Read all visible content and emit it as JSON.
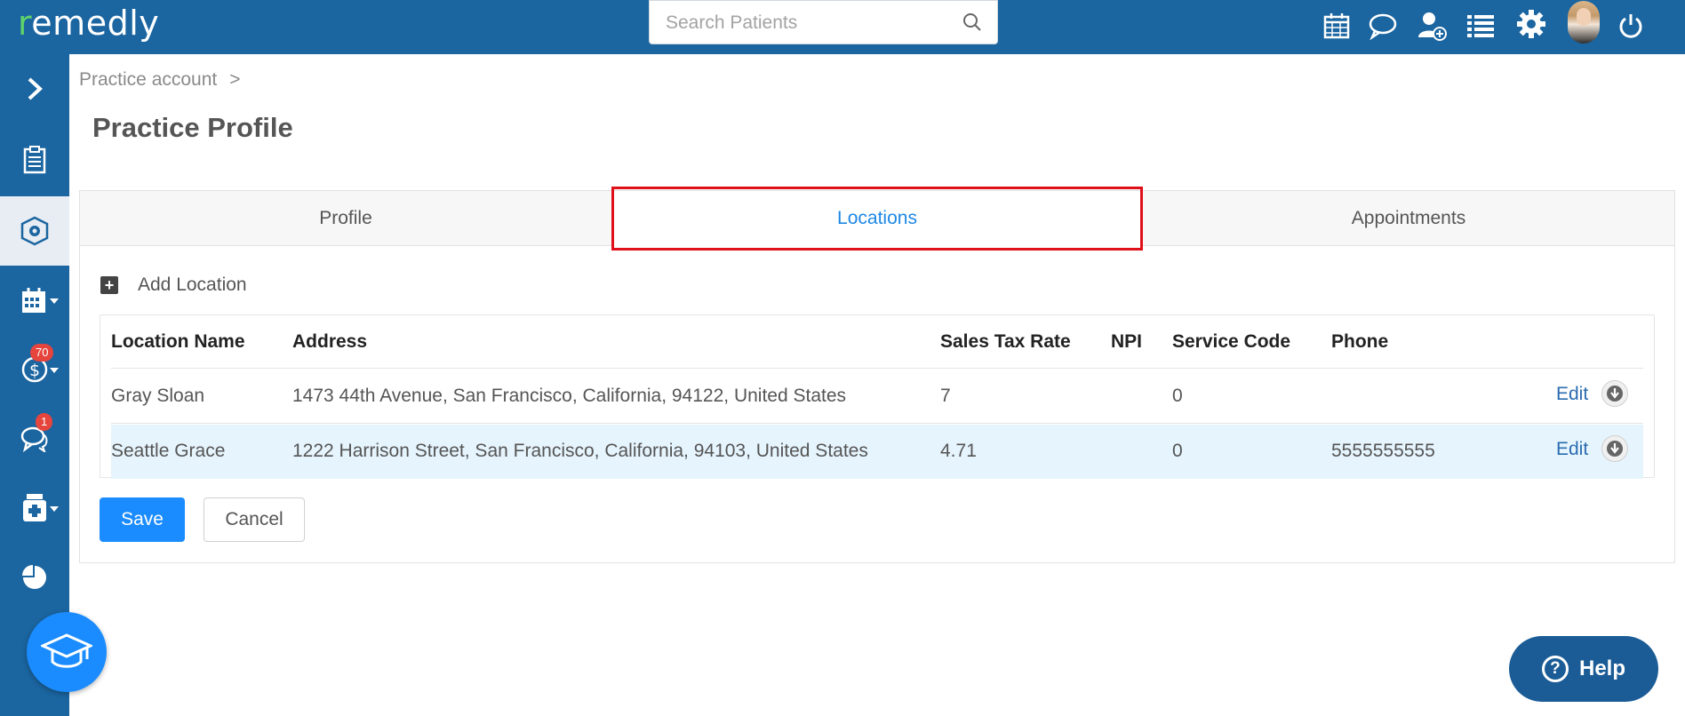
{
  "app": {
    "logo_prefix": "r",
    "logo_rest": "emedly"
  },
  "search": {
    "placeholder": "Search Patients"
  },
  "topnav": {
    "icons": [
      "calendar-icon",
      "chat-icon",
      "add-user-icon",
      "list-icon",
      "gear-icon",
      "avatar",
      "power-icon"
    ]
  },
  "sidebar": {
    "items": [
      {
        "icon": "chevron-right-icon"
      },
      {
        "icon": "clipboard-icon"
      },
      {
        "icon": "practice-settings-icon",
        "active": true
      },
      {
        "icon": "calendar-icon"
      },
      {
        "icon": "billing-icon",
        "badge": "70"
      },
      {
        "icon": "messages-icon",
        "badge": "1"
      },
      {
        "icon": "pharmacy-icon"
      },
      {
        "icon": "reports-icon"
      }
    ]
  },
  "breadcrumb": {
    "item": "Practice account",
    "sep": ">"
  },
  "page": {
    "title": "Practice Profile"
  },
  "tabs": [
    {
      "label": "Profile"
    },
    {
      "label": "Locations",
      "active": true
    },
    {
      "label": "Appointments"
    }
  ],
  "locations": {
    "add_label": "Add Location",
    "columns": [
      "Location Name",
      "Address",
      "Sales Tax Rate",
      "NPI",
      "Service Code",
      "Phone"
    ],
    "rows": [
      {
        "name": "Gray Sloan",
        "address": "1473 44th Avenue, San Francisco, California, 94122, United States",
        "tax": "7",
        "npi": "",
        "service_code": "0",
        "phone": "",
        "edit": "Edit"
      },
      {
        "name": "Seattle Grace",
        "address": "1222 Harrison Street, San Francisco, California, 94103, United States",
        "tax": "4.71",
        "npi": "",
        "service_code": "0",
        "phone": "5555555555",
        "edit": "Edit"
      }
    ]
  },
  "actions": {
    "save": "Save",
    "cancel": "Cancel"
  },
  "help": {
    "label": "Help"
  },
  "colors": {
    "brand": "#1b65a0",
    "accent": "#1a8cff",
    "highlight": "#e0101a",
    "badge": "#e5453d"
  }
}
